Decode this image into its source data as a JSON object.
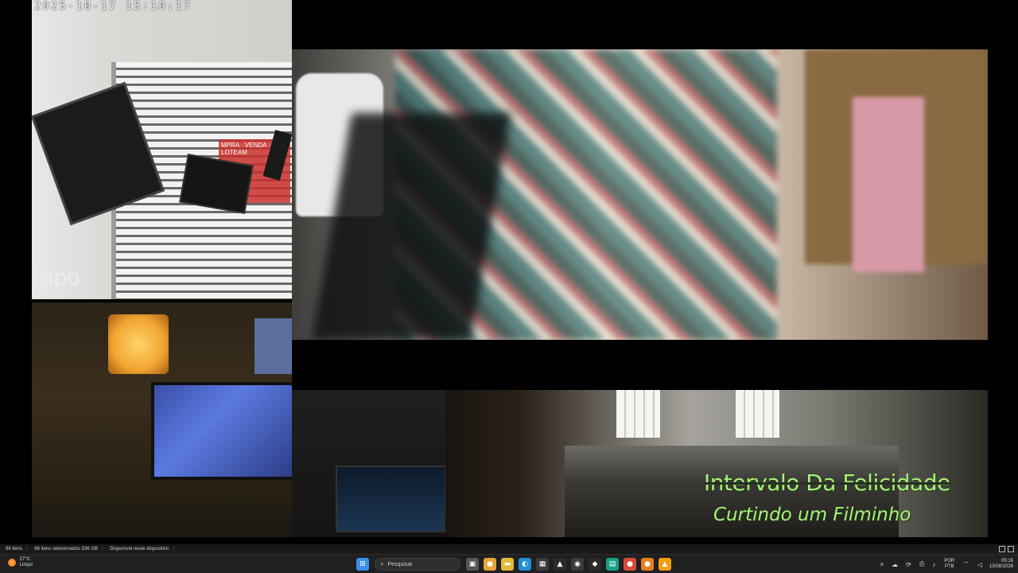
{
  "camera_feed": {
    "timestamp": "2025-10-17  15:10:17",
    "logo": "tapo",
    "sign_text": "MPRA · VENDA · LOTEAM"
  },
  "overlay": {
    "title": "Intervalo Da Felicidade",
    "subtitle": "Curtindo um Filminho",
    "color": "#a8f07a"
  },
  "status_bar": {
    "item_count": "86 itens",
    "selected": "68 itens selecionados  536 GB",
    "availability": "Disponível neste dispositivo"
  },
  "taskbar": {
    "weather": {
      "temp": "27°C",
      "condition": "Limpo"
    },
    "search_placeholder": "Pesquisar",
    "apps": [
      {
        "name": "windows-start-icon",
        "glyph": "⊞",
        "color": "#3b8eea"
      },
      {
        "name": "task-view-icon",
        "glyph": "▣",
        "color": "#555555"
      },
      {
        "name": "chrome-icon",
        "glyph": "●",
        "color": "#e8a33a"
      },
      {
        "name": "file-explorer-icon",
        "glyph": "▬",
        "color": "#e6b83a"
      },
      {
        "name": "edge-icon",
        "glyph": "◐",
        "color": "#1f8fd6"
      },
      {
        "name": "store-icon",
        "glyph": "▦",
        "color": "#3a3a3a"
      },
      {
        "name": "adobe-icon",
        "glyph": "▲",
        "color": "#2a2a2a"
      },
      {
        "name": "obs-icon",
        "glyph": "◉",
        "color": "#3a3a3a"
      },
      {
        "name": "app-icon",
        "glyph": "◆",
        "color": "#2a2a2a"
      },
      {
        "name": "terminal-icon",
        "glyph": "▤",
        "color": "#16a085"
      },
      {
        "name": "chrome-icon-2",
        "glyph": "●",
        "color": "#d94a3a"
      },
      {
        "name": "chrome-icon-3",
        "glyph": "●",
        "color": "#e67e22"
      },
      {
        "name": "vlc-icon",
        "glyph": "▲",
        "color": "#f39c12"
      }
    ],
    "tray": {
      "lang_top": "POR",
      "lang_bottom": "PTB",
      "time": "05:16",
      "date": "13/08/2026"
    }
  }
}
